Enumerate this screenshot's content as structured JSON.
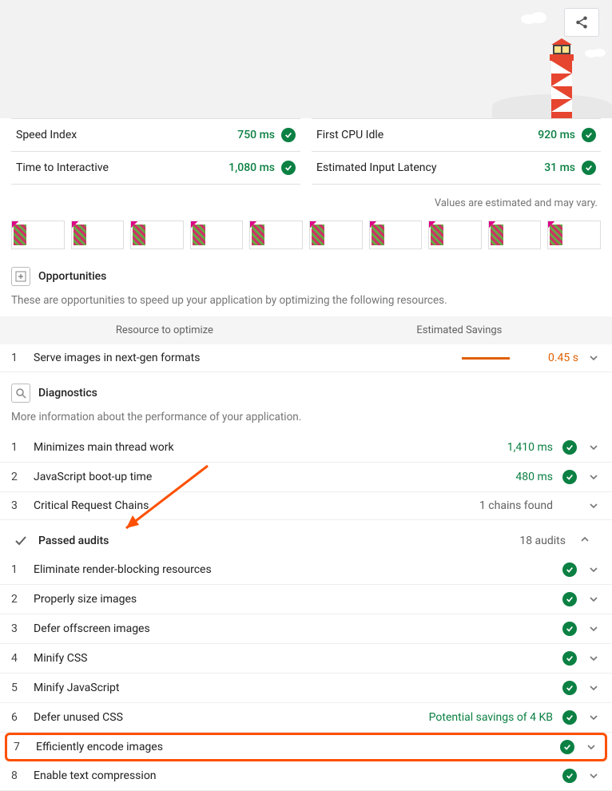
{
  "hero": {
    "share_tooltip": "Share"
  },
  "metrics": {
    "left": [
      {
        "label": "Speed Index",
        "value": "750 ms",
        "status": "pass"
      },
      {
        "label": "Time to Interactive",
        "value": "1,080 ms",
        "status": "pass"
      }
    ],
    "right": [
      {
        "label": "First CPU Idle",
        "value": "920 ms",
        "status": "pass"
      },
      {
        "label": "Estimated Input Latency",
        "value": "31 ms",
        "status": "pass"
      }
    ]
  },
  "note": "Values are estimated and may vary.",
  "opportunities": {
    "title": "Opportunities",
    "desc": "These are opportunities to speed up your application by optimizing the following resources.",
    "col1": "Resource to optimize",
    "col2": "Estimated Savings",
    "items": [
      {
        "n": "1",
        "name": "Serve images in next-gen formats",
        "savings": "0.45 s"
      }
    ]
  },
  "diagnostics": {
    "title": "Diagnostics",
    "desc": "More information about the performance of your application.",
    "items": [
      {
        "n": "1",
        "name": "Minimizes main thread work",
        "value": "1,410 ms",
        "badge": "pass"
      },
      {
        "n": "2",
        "name": "JavaScript boot-up time",
        "value": "480 ms",
        "badge": "pass"
      },
      {
        "n": "3",
        "name": "Critical Request Chains",
        "value": "1 chains found",
        "badge": ""
      }
    ]
  },
  "passed": {
    "title": "Passed audits",
    "count": "18 audits",
    "items": [
      {
        "n": "1",
        "name": "Eliminate render-blocking resources",
        "value": ""
      },
      {
        "n": "2",
        "name": "Properly size images",
        "value": ""
      },
      {
        "n": "3",
        "name": "Defer offscreen images",
        "value": ""
      },
      {
        "n": "4",
        "name": "Minify CSS",
        "value": ""
      },
      {
        "n": "5",
        "name": "Minify JavaScript",
        "value": ""
      },
      {
        "n": "6",
        "name": "Defer unused CSS",
        "value": "Potential savings of 4 KB"
      },
      {
        "n": "7",
        "name": "Efficiently encode images",
        "value": ""
      },
      {
        "n": "8",
        "name": "Enable text compression",
        "value": ""
      }
    ]
  }
}
